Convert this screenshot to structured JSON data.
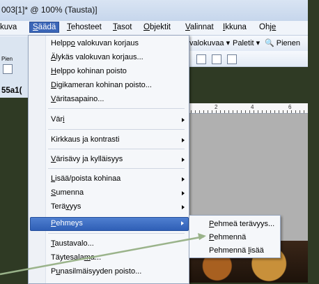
{
  "window": {
    "title": "003[1]* @ 100% (Tausta)]"
  },
  "menubar": [
    {
      "label": "kuva",
      "ul": ""
    },
    {
      "label": "äädä",
      "ul": "S"
    },
    {
      "label": "ehosteet",
      "ul": "T"
    },
    {
      "label": "asot",
      "ul": "T"
    },
    {
      "label": "bjektit",
      "ul": "O"
    },
    {
      "label": "alinnat",
      "ul": "V"
    },
    {
      "label": "kkuna",
      "ul": "I"
    },
    {
      "label": "Oh",
      "ul": "je"
    }
  ],
  "toolbar": {
    "valokuvaa": "valokuvaa",
    "paletit": "Paletit",
    "pienenna": "Pienen",
    "pien_left": "Pien",
    "docname": "55a1("
  },
  "ruler": {
    "ticks": [
      "2",
      "4",
      "6"
    ]
  },
  "menu": {
    "items": [
      {
        "pre": "Helpp",
        "ul": "o",
        "post": " valokuvan korjaus"
      },
      {
        "pre": "",
        "ul": "Ä",
        "post": "lykäs valokuvan korjaus..."
      },
      {
        "pre": "",
        "ul": "H",
        "post": "elppo kohinan poisto"
      },
      {
        "pre": "",
        "ul": "D",
        "post": "igikameran kohinan poisto..."
      },
      {
        "pre": "",
        "ul": "V",
        "post": "äritasapaino..."
      },
      {
        "pre": "Vär",
        "ul": "i",
        "post": ""
      },
      {
        "pre": "Kirkkaus ja kontrasti",
        "ul": "",
        "post": ""
      },
      {
        "pre": "",
        "ul": "V",
        "post": "ärisävy ja kylläisyys"
      },
      {
        "pre": "",
        "ul": "L",
        "post": "isää/poista kohinaa"
      },
      {
        "pre": "",
        "ul": "S",
        "post": "umenna"
      },
      {
        "pre": "Terä",
        "ul": "v",
        "post": "yys"
      },
      {
        "pre": "",
        "ul": "P",
        "post": "ehmeys"
      },
      {
        "pre": "",
        "ul": "T",
        "post": "austavalo..."
      },
      {
        "pre": "Täytesala",
        "ul": "m",
        "post": "a..."
      },
      {
        "pre": "P",
        "ul": "u",
        "post": "nasilmäisyyden poisto..."
      }
    ]
  },
  "submenu": {
    "items": [
      {
        "pre": "",
        "ul": "P",
        "post": "ehmeä terävyys..."
      },
      {
        "pre": "",
        "ul": "P",
        "post": "ehmennä"
      },
      {
        "pre": "Pehmennä ",
        "ul": "l",
        "post": "isää"
      }
    ]
  },
  "colors": {
    "highlight": "#3b66b8",
    "accent_line": "#9ab38a",
    "background": "#2f3a24"
  }
}
